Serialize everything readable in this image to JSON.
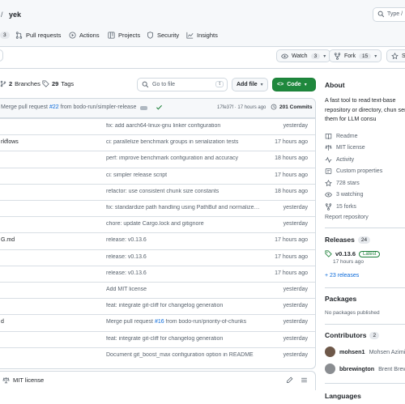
{
  "header": {
    "slash": "/",
    "repo_name": "yek",
    "search_placeholder": "Type /"
  },
  "nav": {
    "issues_count": "3",
    "pull_requests": "Pull requests",
    "actions": "Actions",
    "projects": "Projects",
    "security": "Security",
    "insights": "Insights"
  },
  "repo_actions": {
    "watch_label": "Watch",
    "watch_count": "3",
    "fork_label": "Fork",
    "fork_count": "15",
    "star_label": "St"
  },
  "branch_bar": {
    "branches_count": "2",
    "branches_label": "Branches",
    "tags_count": "29",
    "tags_label": "Tags",
    "go_to_file_placeholder": "Go to file",
    "go_to_file_key": "t",
    "add_file_label": "Add file",
    "code_label": "Code"
  },
  "latest_commit": {
    "prefix": "Merge pull request",
    "pr_link": "#22",
    "suffix": "from bodo-run/simpler-release",
    "hash_time": "17fe37f · 17 hours ago",
    "commits_label": "201 Commits"
  },
  "files": [
    {
      "name": "",
      "message": "fix: add aarch64-linux-gnu linker configuration",
      "time": "yesterday"
    },
    {
      "name": "rkflows",
      "message": "ci: parallelize benchmark groups in serialization tests",
      "time": "17 hours ago"
    },
    {
      "name": "",
      "message": "perf: improve benchmark configuration and accuracy",
      "time": "18 hours ago"
    },
    {
      "name": "",
      "message": "ci: simpler release script",
      "time": "17 hours ago"
    },
    {
      "name": "",
      "message": "refactor: use consistent chunk size constants",
      "time": "18 hours ago"
    },
    {
      "name": "",
      "message": "fix: standardize path handling using PathBuf and normalize_…",
      "time": "yesterday"
    },
    {
      "name": "",
      "message": "chore: update Cargo.lock and gitignore",
      "time": "yesterday"
    },
    {
      "name": "G.md",
      "message": "release: v0.13.6",
      "time": "17 hours ago"
    },
    {
      "name": "",
      "message": "release: v0.13.6",
      "time": "17 hours ago"
    },
    {
      "name": "",
      "message": "release: v0.13.6",
      "time": "17 hours ago"
    },
    {
      "name": "",
      "message": "Add MIT license",
      "time": "yesterday"
    },
    {
      "name": "",
      "message": "feat: integrate git-cliff for changelog generation",
      "time": "yesterday"
    },
    {
      "name": "d",
      "message": "Merge pull request",
      "message_link": "#16",
      "message_suffix": "from bodo-run/priority-of-chunks",
      "time": "yesterday"
    },
    {
      "name": "",
      "message": "feat: integrate git-cliff for changelog generation",
      "time": "yesterday"
    },
    {
      "name": "",
      "message": "Document git_boost_max configuration option in README",
      "time": "yesterday"
    }
  ],
  "license_tab": {
    "label": "MIT license"
  },
  "sidebar": {
    "about_title": "About",
    "description": "A fast tool to read text-base repository or directory, chun serialize them for LLM consu",
    "readme": "Readme",
    "license": "MIT license",
    "activity": "Activity",
    "custom_properties": "Custom properties",
    "stars": "728 stars",
    "watching": "3 watching",
    "forks": "15 forks",
    "report": "Report repository",
    "releases_title": "Releases",
    "releases_count": "24",
    "release_version": "v0.13.6",
    "latest_badge": "Latest",
    "release_time": "17 hours ago",
    "more_releases": "+ 23 releases",
    "packages_title": "Packages",
    "packages_none": "No packages published",
    "contributors_title": "Contributors",
    "contributors_count": "2",
    "contributors": [
      {
        "login": "mohsen1",
        "name": "Mohsen Azimi"
      },
      {
        "login": "bbrewington",
        "name": "Brent Brewi"
      }
    ],
    "languages_title": "Languages"
  },
  "colors": {
    "accent": "#0969da",
    "code_button": "#1f883d",
    "success": "#1a7f37",
    "border": "#d1d9e0"
  }
}
